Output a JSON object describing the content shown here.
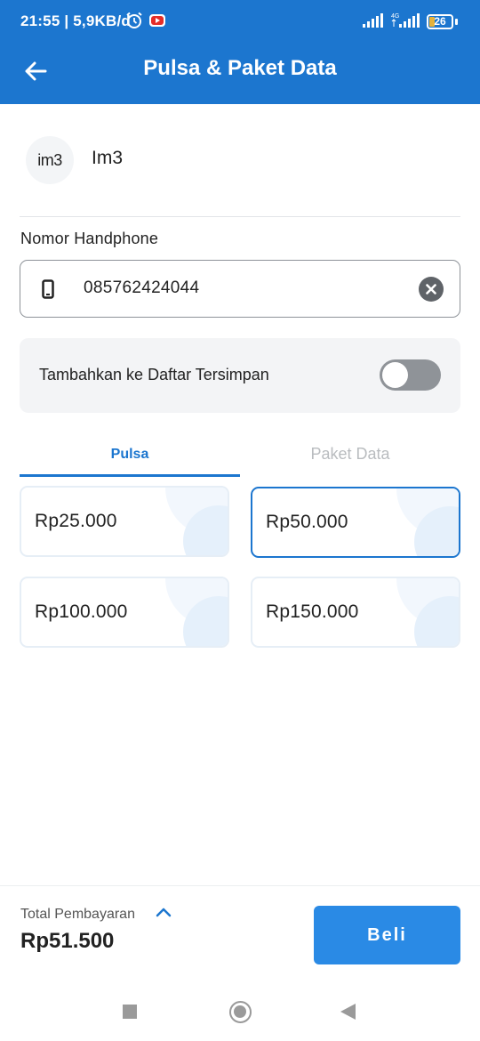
{
  "status_bar": {
    "time_speed": "21:55 | 5,9KB/d",
    "network_type": "4G",
    "battery": "26",
    "battery_level": 0.26
  },
  "header": {
    "title": "Pulsa & Paket Data",
    "back_icon": "arrow-left-icon"
  },
  "operator": {
    "logo_text": "im3",
    "name": "Im3"
  },
  "phone": {
    "label": "Nomor Handphone",
    "value": "085762424044",
    "icon": "smartphone-icon",
    "clear_icon": "clear-icon"
  },
  "save_toggle": {
    "label": "Tambahkan ke Daftar Tersimpan",
    "on": false
  },
  "tabs": [
    {
      "label": "Pulsa",
      "active": true
    },
    {
      "label": "Paket Data",
      "active": false
    }
  ],
  "options": [
    {
      "label": "Rp25.000",
      "selected": false
    },
    {
      "label": "Rp50.000",
      "selected": true
    },
    {
      "label": "Rp100.000",
      "selected": false
    },
    {
      "label": "Rp150.000",
      "selected": false
    }
  ],
  "footer": {
    "total_label": "Total Pembayaran",
    "total_value": "Rp51.500",
    "buy_label": "Beli"
  },
  "colors": {
    "primary": "#1c76cf",
    "button": "#2a8ae5"
  }
}
